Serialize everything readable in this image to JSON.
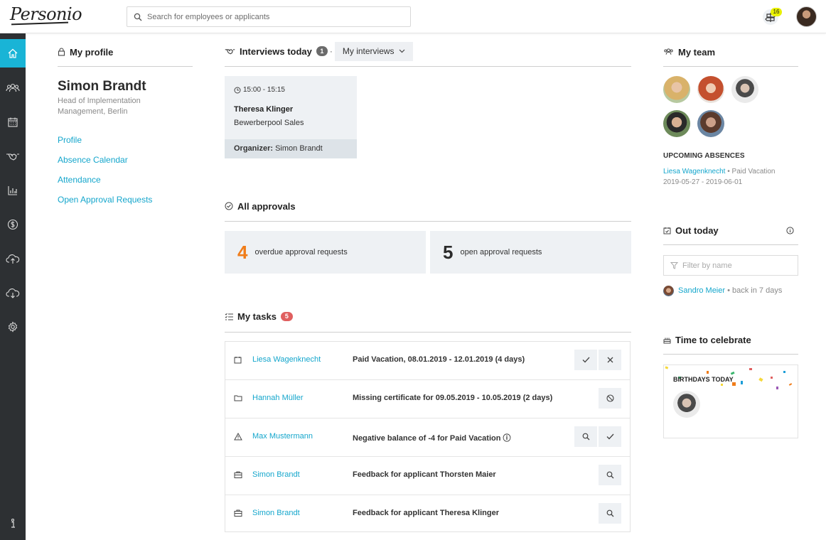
{
  "header": {
    "logo_text": "Personio",
    "search_placeholder": "Search for employees or applicants",
    "notification_count": "16"
  },
  "sidebar": {
    "items": [
      {
        "name": "home-icon",
        "active": true
      },
      {
        "name": "people-icon",
        "active": false
      },
      {
        "name": "calendar-icon",
        "active": false
      },
      {
        "name": "handshake-icon",
        "active": false
      },
      {
        "name": "chart-icon",
        "active": false
      },
      {
        "name": "dollar-icon",
        "active": false
      },
      {
        "name": "cloud-upload-icon",
        "active": false
      },
      {
        "name": "cloud-download-icon",
        "active": false
      },
      {
        "name": "gear-icon",
        "active": false
      },
      {
        "name": "info-icon",
        "active": false
      }
    ]
  },
  "profile": {
    "heading": "My profile",
    "name": "Simon Brandt",
    "role": "Head of Implementation Management, Berlin",
    "links": [
      "Profile",
      "Absence Calendar",
      "Attendance",
      "Open Approval Requests"
    ]
  },
  "interviews": {
    "heading": "Interviews today",
    "count": "1",
    "dot": "·",
    "dropdown_label": "My interviews",
    "card": {
      "time": "15:00 - 15:15",
      "name": "Theresa Klinger",
      "company": "Bewerberpool Sales",
      "organizer_label": "Organizer:",
      "organizer_name": "Simon Brandt"
    }
  },
  "approvals": {
    "heading": "All approvals",
    "overdue_count": "4",
    "overdue_label": "overdue approval requests",
    "open_count": "5",
    "open_label": "open approval requests"
  },
  "tasks": {
    "heading": "My tasks",
    "count": "5",
    "rows": [
      {
        "icon": "calendar-icon",
        "name": "Liesa Wagenknecht",
        "desc": "Paid Vacation, 08.01.2019 - 12.01.2019 (4 days)",
        "actions": [
          "check-icon",
          "close-icon"
        ]
      },
      {
        "icon": "folder-icon",
        "name": "Hannah Müller",
        "desc": "Missing certificate for 09.05.2019 - 10.05.2019 (2 days)",
        "actions": [
          "block-icon"
        ]
      },
      {
        "icon": "warning-icon",
        "name": "Max Mustermann",
        "desc": "Negative balance of -4 for Paid Vacation ⓘ",
        "actions": [
          "search-icon",
          "check-icon"
        ]
      },
      {
        "icon": "briefcase-icon",
        "name": "Simon Brandt",
        "desc": "Feedback for applicant Thorsten Maier",
        "actions": [
          "search-icon"
        ]
      },
      {
        "icon": "briefcase-icon",
        "name": "Simon Brandt",
        "desc": "Feedback for applicant Theresa Klinger",
        "actions": [
          "search-icon"
        ]
      }
    ]
  },
  "team": {
    "heading": "My team",
    "upcoming_heading": "UPCOMING ABSENCES",
    "absence_name": "Liesa Wagenknecht",
    "absence_sep": " • ",
    "absence_type": "Paid Vacation",
    "absence_dates": "2019-05-27 - 2019-06-01"
  },
  "out_today": {
    "heading": "Out today",
    "filter_placeholder": "Filter by name",
    "person": "Sandro Meier",
    "sep": " • ",
    "status": "back in 7 days"
  },
  "celebrate": {
    "heading": "Time to celebrate",
    "birthdays_label": "BIRTHDAYS TODAY"
  },
  "colors": {
    "accent": "#19b4d6",
    "link": "#14a6cc",
    "overdue": "#f07d1a",
    "sidebar": "#2d3033",
    "task_badge": "#e05f5f"
  }
}
